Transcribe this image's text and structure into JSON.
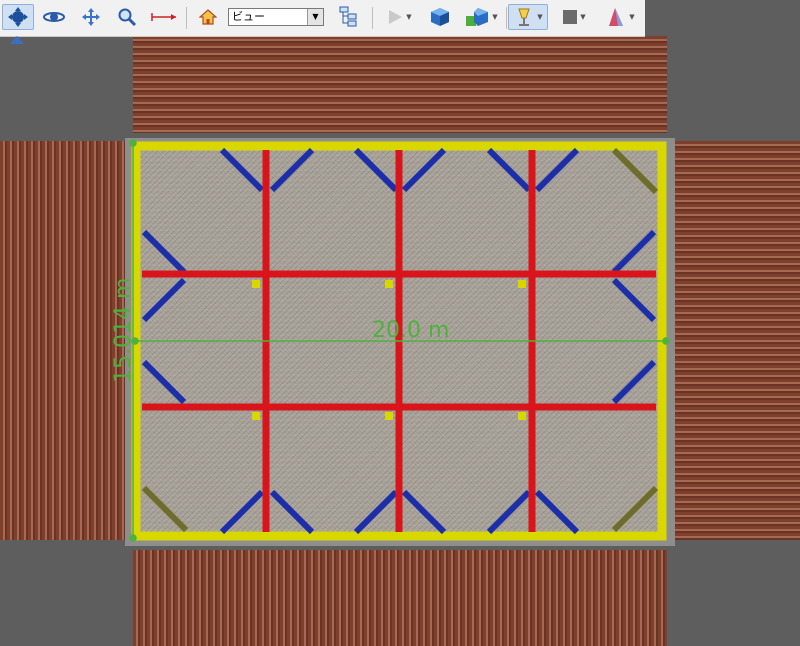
{
  "toolbar": {
    "buttons": [
      {
        "name": "view-navigate-button",
        "icon": "four-way-move-icon"
      },
      {
        "name": "orbit-button",
        "icon": "orbit-icon"
      },
      {
        "name": "pan-button",
        "icon": "pan-icon"
      },
      {
        "name": "zoom-button",
        "icon": "magnifier-icon"
      },
      {
        "name": "measure-button",
        "icon": "measure-line-icon"
      },
      {
        "name": "home-button",
        "icon": "house-icon"
      },
      {
        "name": "tree-button",
        "icon": "tree-icon"
      },
      {
        "name": "play-button",
        "icon": "play-icon"
      },
      {
        "name": "solid-cube-button",
        "icon": "cube-icon"
      },
      {
        "name": "multi-cube-button",
        "icon": "cubes-icon"
      },
      {
        "name": "lighting-button",
        "icon": "lamp-icon"
      },
      {
        "name": "color-button",
        "icon": "gray-square-icon"
      },
      {
        "name": "material-button",
        "icon": "material-icon"
      }
    ],
    "view_select_value": "ビュー"
  },
  "dimensions": {
    "width_label": "20.0 m",
    "height_label": "15.014 m"
  },
  "colors": {
    "beam_outer": "#d8d800",
    "beam_red": "#d9141b",
    "brace_blue": "#1c2fa8",
    "brace_olive": "#6f6d2c",
    "dimension": "#4fb13d"
  }
}
